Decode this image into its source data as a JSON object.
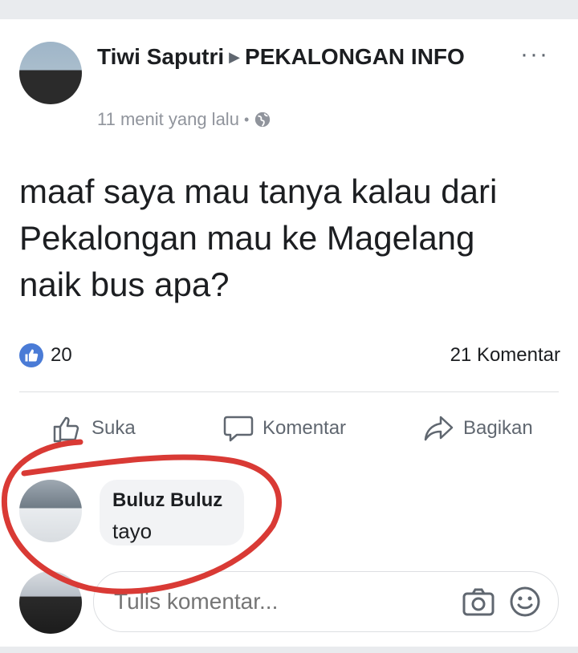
{
  "post": {
    "author": "Tiwi Saputri",
    "group": "PEKALONGAN INFO",
    "time": "11 menit yang lalu",
    "dot": "•",
    "more": "···",
    "text": "maaf saya mau tanya kalau dari Pekalongan mau ke Magelang naik bus apa?"
  },
  "stats": {
    "likes": "20",
    "comments": "21 Komentar"
  },
  "actions": {
    "like": "Suka",
    "comment": "Komentar",
    "share": "Bagikan"
  },
  "comment": {
    "author": "Buluz Buluz",
    "text": "tayo"
  },
  "composer": {
    "placeholder": "Tulis komentar..."
  },
  "colors": {
    "like_blue": "#4a7bd6",
    "annotation_red": "#d93a35",
    "muted": "#90949c"
  },
  "icons": [
    "globe-icon",
    "like-icon",
    "comment-icon",
    "share-icon",
    "camera-icon",
    "emoji-icon",
    "more-icon"
  ]
}
